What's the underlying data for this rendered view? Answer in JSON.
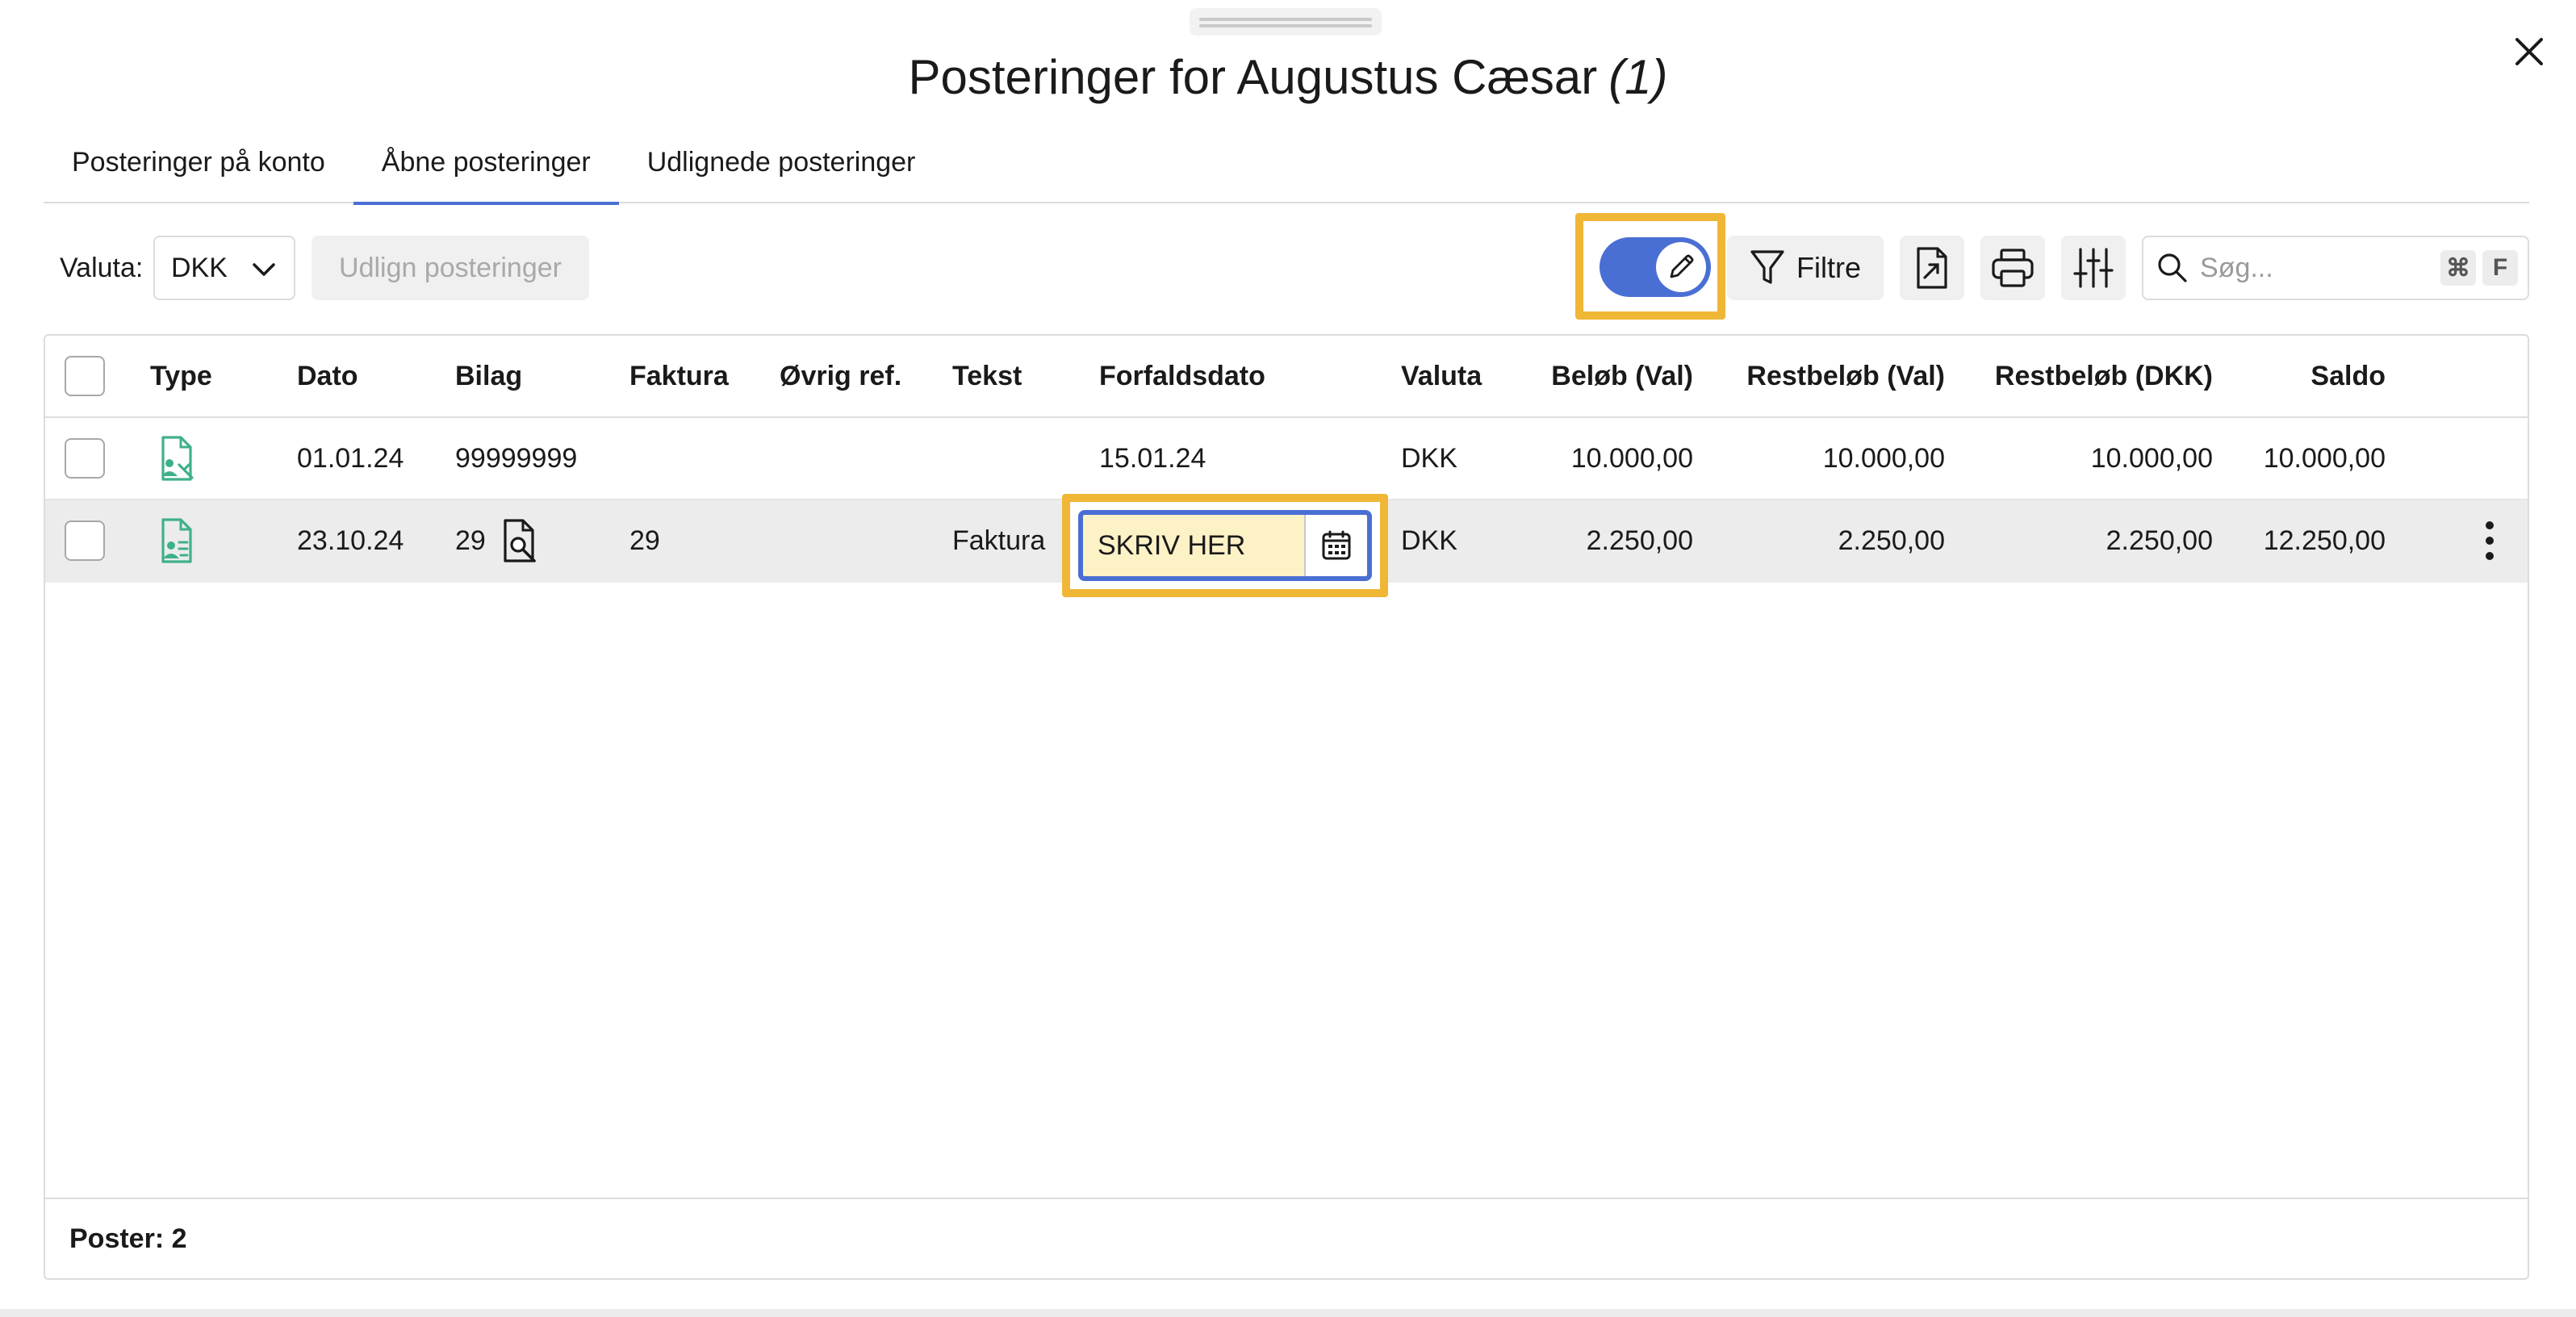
{
  "dialog": {
    "title": "Posteringer for Augustus Cæsar",
    "title_count": "(1)"
  },
  "tabs": [
    {
      "label": "Posteringer på konto",
      "active": false
    },
    {
      "label": "Åbne posteringer",
      "active": true
    },
    {
      "label": "Udlignede posteringer",
      "active": false
    }
  ],
  "toolbar": {
    "currency_label": "Valuta:",
    "currency_value": "DKK",
    "settle_button": "Udlign posteringer",
    "edit_toggle_on": true,
    "filter_button": "Filtre",
    "search_placeholder": "Søg...",
    "shortcut_cmd": "⌘",
    "shortcut_key": "F"
  },
  "table": {
    "columns": [
      "Type",
      "Dato",
      "Bilag",
      "Faktura",
      "Øvrig ref.",
      "Tekst",
      "Forfaldsdato",
      "Valuta",
      "Beløb (Val)",
      "Restbeløb (Val)",
      "Restbeløb (DKK)",
      "Saldo"
    ],
    "rows": [
      {
        "type_icon": "customer-document-icon",
        "dato": "01.01.24",
        "bilag": "99999999",
        "faktura": "",
        "ovrig_ref": "",
        "tekst": "",
        "forfaldsdato": "15.01.24",
        "valuta": "DKK",
        "belob_val": "10.000,00",
        "restbelob_val": "10.000,00",
        "restbelob_dkk": "10.000,00",
        "saldo": "10.000,00"
      },
      {
        "type_icon": "invoice-document-icon",
        "dato": "23.10.24",
        "bilag": "29",
        "faktura": "29",
        "ovrig_ref": "",
        "tekst": "Faktura",
        "forfaldsdato": "SKRIV HER",
        "valuta": "DKK",
        "belob_val": "2.250,00",
        "restbelob_val": "2.250,00",
        "restbelob_dkk": "2.250,00",
        "saldo": "12.250,00"
      }
    ],
    "footer": "Poster: 2"
  },
  "colors": {
    "accent": "#4a6fd4",
    "highlight": "#f0b636",
    "type_icon": "#3fb08c",
    "edit_field_bg": "#fdf1c6"
  }
}
